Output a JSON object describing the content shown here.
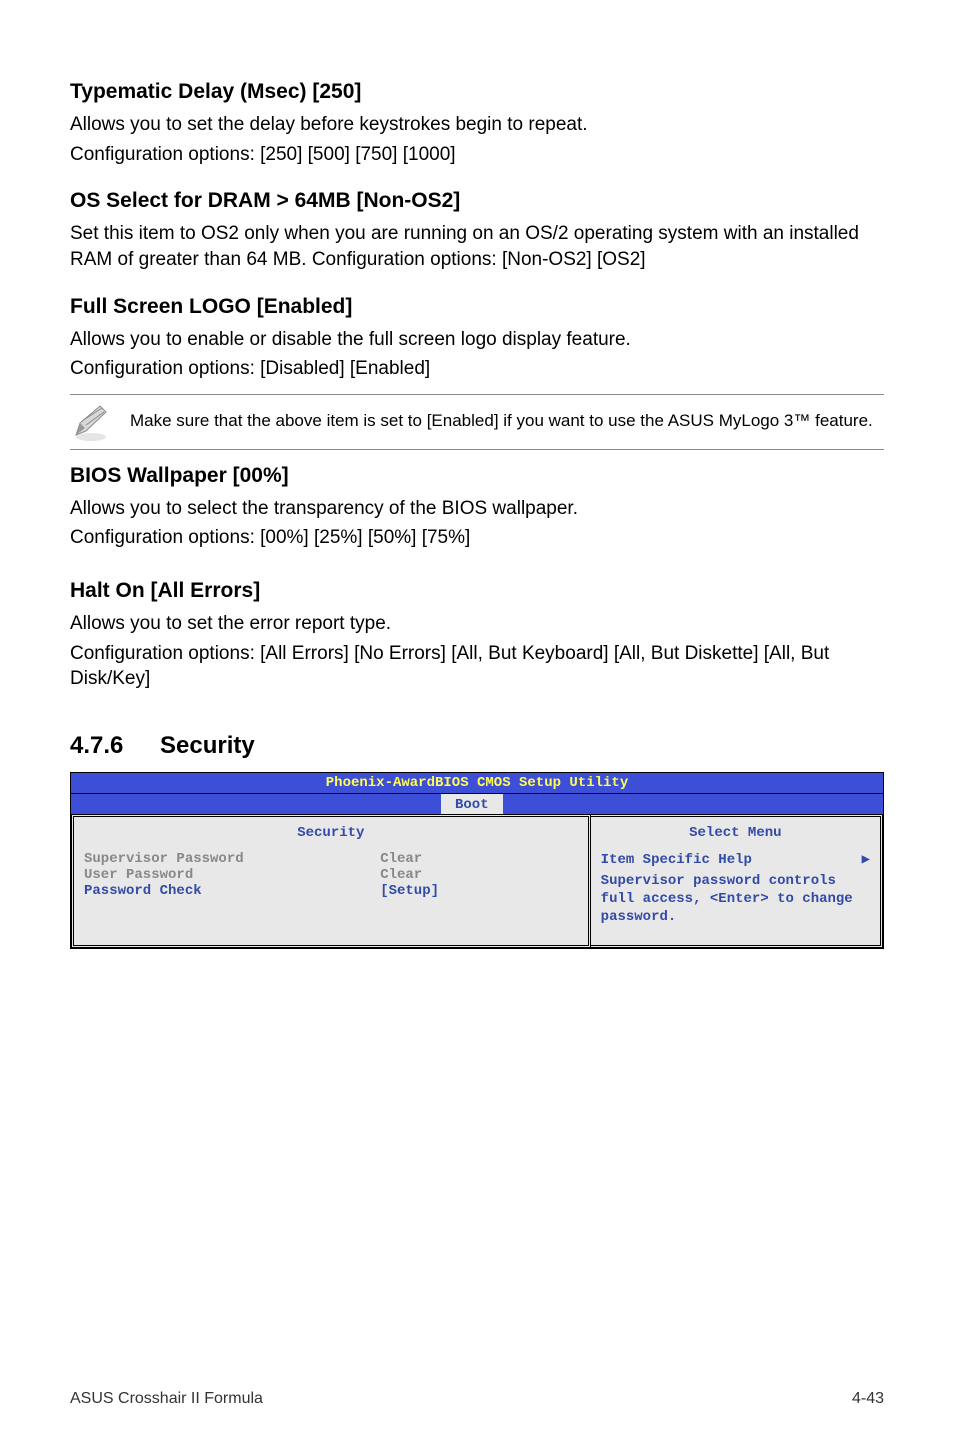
{
  "sections": {
    "typematic": {
      "heading": "Typematic Delay (Msec) [250]",
      "line1": "Allows you to set the delay before keystrokes begin to repeat.",
      "line2": "Configuration options: [250] [500] [750] [1000]"
    },
    "osselect": {
      "heading": "OS Select for DRAM > 64MB [Non-OS2]",
      "line1": "Set this item to OS2 only when you are running on an OS/2 operating system with an installed RAM of greater than 64 MB. Configuration options: [Non-OS2] [OS2]"
    },
    "fullscreen": {
      "heading": "Full Screen LOGO [Enabled]",
      "line1": "Allows you to enable or disable the full screen logo display feature.",
      "line2": "Configuration options: [Disabled] [Enabled]"
    },
    "note": {
      "text": "Make sure that the above item is set to [Enabled] if you want to use the ASUS MyLogo 3™ feature."
    },
    "wallpaper": {
      "heading": "BIOS Wallpaper [00%]",
      "line1": "Allows you to select the transparency of the BIOS wallpaper.",
      "line2": "Configuration options: [00%] [25%] [50%] [75%]"
    },
    "halt": {
      "heading": "Halt On [All Errors]",
      "line1": "Allows you to set the error report type.",
      "line2": "Configuration options: [All Errors] [No Errors] [All, But Keyboard] [All, But Diskette] [All, But Disk/Key]"
    }
  },
  "security_title": {
    "num": "4.7.6",
    "label": "Security"
  },
  "bios": {
    "title": "Phoenix-AwardBIOS CMOS Setup Utility",
    "tab": "Boot",
    "left_head": "Security",
    "right_head": "Select Menu",
    "rows": {
      "r0": {
        "label": "Supervisor Password",
        "value": "Clear"
      },
      "r1": {
        "label": "User Password",
        "value": "Clear"
      },
      "r2": {
        "label": "Password Check",
        "value": "[Setup]"
      }
    },
    "help": {
      "head": "Item Specific Help",
      "body": "Supervisor password controls full access, <Enter> to change password."
    }
  },
  "footer": {
    "left": "ASUS Crosshair II Formula",
    "right": "4-43"
  }
}
